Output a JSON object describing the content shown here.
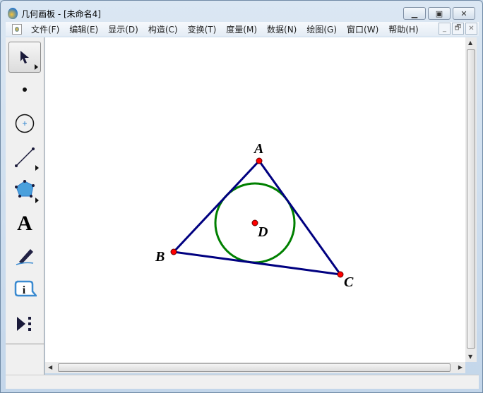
{
  "window": {
    "title": "几何画板 - [未命名4]"
  },
  "menu": [
    "文件(F)",
    "编辑(E)",
    "显示(D)",
    "构造(C)",
    "变换(T)",
    "度量(M)",
    "数据(N)",
    "绘图(G)",
    "窗口(W)",
    "帮助(H)"
  ],
  "tools": [
    "arrow-tool",
    "point-tool",
    "compass-tool",
    "straightedge-tool",
    "polygon-tool",
    "text-tool",
    "marker-tool",
    "information-tool",
    "custom-tool"
  ],
  "canvas": {
    "points": {
      "A": "A",
      "B": "B",
      "C": "C",
      "D": "D"
    }
  },
  "colors": {
    "triangle": "#000080",
    "incircle": "#008000",
    "point": "#ff0000"
  }
}
